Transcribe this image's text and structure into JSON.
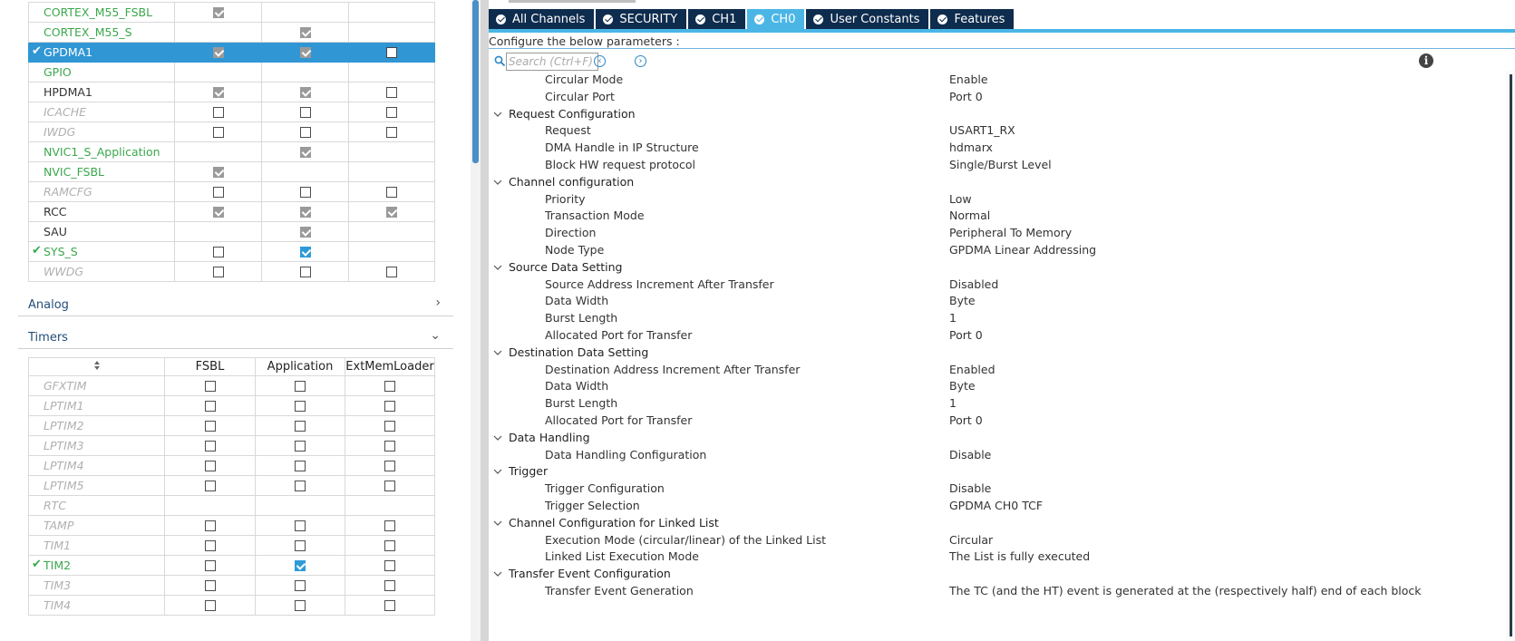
{
  "peripherals_top": {
    "rows": [
      {
        "name": "CORTEX_M55_FSBL",
        "style": "ok",
        "mark": "",
        "cells": [
          "on",
          "",
          ""
        ]
      },
      {
        "name": "CORTEX_M55_S",
        "style": "ok",
        "mark": "",
        "cells": [
          "",
          "on",
          ""
        ]
      },
      {
        "name": "GPDMA1",
        "style": "sel",
        "mark": "✔",
        "cells": [
          "on",
          "on",
          "wb"
        ]
      },
      {
        "name": "GPIO",
        "style": "ok",
        "mark": "",
        "cells": [
          "",
          "",
          ""
        ]
      },
      {
        "name": "HPDMA1",
        "style": "norm",
        "mark": "",
        "cells": [
          "on",
          "on",
          "off"
        ]
      },
      {
        "name": "ICACHE",
        "style": "dis",
        "mark": "",
        "cells": [
          "off",
          "off",
          "off"
        ]
      },
      {
        "name": "IWDG",
        "style": "dis",
        "mark": "",
        "cells": [
          "off",
          "off",
          "off"
        ]
      },
      {
        "name": "NVIC1_S_Application",
        "style": "ok",
        "mark": "",
        "cells": [
          "",
          "on",
          ""
        ]
      },
      {
        "name": "NVIC_FSBL",
        "style": "ok",
        "mark": "",
        "cells": [
          "on",
          "",
          ""
        ]
      },
      {
        "name": "RAMCFG",
        "style": "dis",
        "mark": "",
        "cells": [
          "off",
          "off",
          "off"
        ]
      },
      {
        "name": "RCC",
        "style": "norm",
        "mark": "",
        "cells": [
          "on",
          "on",
          "on"
        ]
      },
      {
        "name": "SAU",
        "style": "norm",
        "mark": "",
        "cells": [
          "",
          "on",
          ""
        ]
      },
      {
        "name": "SYS_S",
        "style": "ok",
        "mark": "✔",
        "cells": [
          "off",
          "blue",
          ""
        ]
      },
      {
        "name": "WWDG",
        "style": "dis",
        "mark": "",
        "cells": [
          "off",
          "off",
          "off"
        ]
      }
    ]
  },
  "sections": {
    "analog": {
      "label": "Analog",
      "chevron": "›"
    },
    "timers": {
      "label": "Timers",
      "chevron": "⌄"
    }
  },
  "timers_table": {
    "sort_icon": "sort-icon",
    "columns": [
      "FSBL",
      "Application",
      "ExtMemLoader"
    ],
    "rows": [
      {
        "name": "GFXTIM",
        "style": "dis",
        "mark": "",
        "cells": [
          "off",
          "off",
          "off"
        ]
      },
      {
        "name": "LPTIM1",
        "style": "dis",
        "mark": "",
        "cells": [
          "off",
          "off",
          "off"
        ]
      },
      {
        "name": "LPTIM2",
        "style": "dis",
        "mark": "",
        "cells": [
          "off",
          "off",
          "off"
        ]
      },
      {
        "name": "LPTIM3",
        "style": "dis",
        "mark": "",
        "cells": [
          "off",
          "off",
          "off"
        ]
      },
      {
        "name": "LPTIM4",
        "style": "dis",
        "mark": "",
        "cells": [
          "off",
          "off",
          "off"
        ]
      },
      {
        "name": "LPTIM5",
        "style": "dis",
        "mark": "",
        "cells": [
          "off",
          "off",
          "off"
        ]
      },
      {
        "name": "RTC",
        "style": "dis",
        "mark": "",
        "cells": [
          "",
          "",
          ""
        ]
      },
      {
        "name": "TAMP",
        "style": "dis",
        "mark": "",
        "cells": [
          "off",
          "off",
          "off"
        ]
      },
      {
        "name": "TIM1",
        "style": "dis",
        "mark": "",
        "cells": [
          "off",
          "off",
          "off"
        ]
      },
      {
        "name": "TIM2",
        "style": "ok",
        "mark": "✔",
        "cells": [
          "off",
          "blue",
          "off"
        ]
      },
      {
        "name": "TIM3",
        "style": "dis",
        "mark": "",
        "cells": [
          "off",
          "off",
          "off"
        ]
      },
      {
        "name": "TIM4",
        "style": "dis",
        "mark": "",
        "cells": [
          "off",
          "off",
          "off"
        ]
      }
    ]
  },
  "tabs": [
    {
      "label": "All Channels",
      "active": false
    },
    {
      "label": "SECURITY",
      "active": false
    },
    {
      "label": "CH1",
      "active": false
    },
    {
      "label": "CH0",
      "active": true
    },
    {
      "label": "User Constants",
      "active": false
    },
    {
      "label": "Features",
      "active": false
    }
  ],
  "config": {
    "label": "Configure the below parameters :",
    "search_placeholder": "Search (Ctrl+F)",
    "prev_symbol": "‹",
    "next_symbol": "›",
    "info_symbol": "i"
  },
  "params": [
    {
      "kind": "item",
      "name": "Circular Mode",
      "value": "Enable"
    },
    {
      "kind": "item",
      "name": "Circular Port",
      "value": "Port 0"
    },
    {
      "kind": "group",
      "name": "Request Configuration"
    },
    {
      "kind": "item",
      "name": "Request",
      "value": "USART1_RX"
    },
    {
      "kind": "item",
      "name": "DMA Handle in IP Structure",
      "value": "hdmarx"
    },
    {
      "kind": "item",
      "name": "Block HW request protocol",
      "value": "Single/Burst Level"
    },
    {
      "kind": "group",
      "name": "Channel configuration"
    },
    {
      "kind": "item",
      "name": "Priority",
      "value": "Low"
    },
    {
      "kind": "item",
      "name": "Transaction Mode",
      "value": "Normal"
    },
    {
      "kind": "item",
      "name": "Direction",
      "value": "Peripheral To Memory"
    },
    {
      "kind": "item",
      "name": "Node Type",
      "value": "GPDMA Linear Addressing"
    },
    {
      "kind": "group",
      "name": "Source Data Setting"
    },
    {
      "kind": "item",
      "name": "Source Address Increment After Transfer",
      "value": "Disabled"
    },
    {
      "kind": "item",
      "name": "Data Width",
      "value": "Byte"
    },
    {
      "kind": "item",
      "name": "Burst Length",
      "value": "1"
    },
    {
      "kind": "item",
      "name": "Allocated Port for Transfer",
      "value": "Port 0"
    },
    {
      "kind": "group",
      "name": "Destination Data Setting"
    },
    {
      "kind": "item",
      "name": "Destination Address Increment After Transfer",
      "value": "Enabled"
    },
    {
      "kind": "item",
      "name": "Data Width",
      "value": "Byte"
    },
    {
      "kind": "item",
      "name": "Burst Length",
      "value": "1"
    },
    {
      "kind": "item",
      "name": "Allocated Port for Transfer",
      "value": "Port 0"
    },
    {
      "kind": "group",
      "name": "Data Handling"
    },
    {
      "kind": "item",
      "name": "Data Handling Configuration",
      "value": "Disable"
    },
    {
      "kind": "group",
      "name": "Trigger"
    },
    {
      "kind": "item",
      "name": "Trigger Configuration",
      "value": "Disable"
    },
    {
      "kind": "item",
      "name": "Trigger Selection",
      "value": "GPDMA CH0 TCF"
    },
    {
      "kind": "group",
      "name": "Channel Configuration for Linked List"
    },
    {
      "kind": "item",
      "name": "Execution Mode (circular/linear) of the Linked List",
      "value": "Circular"
    },
    {
      "kind": "item",
      "name": "Linked List Execution Mode",
      "value": "The List is fully executed"
    },
    {
      "kind": "group",
      "name": "Transfer Event Configuration"
    },
    {
      "kind": "item",
      "name": "Transfer Event Generation",
      "value": "The TC (and the HT) event is generated at the (respectively half) end of each block"
    }
  ],
  "colors": {
    "accent": "#4bb6e6",
    "tab_bg": "#0e2c4d",
    "selection": "#3096d4",
    "ok_green": "#3aa84c"
  }
}
